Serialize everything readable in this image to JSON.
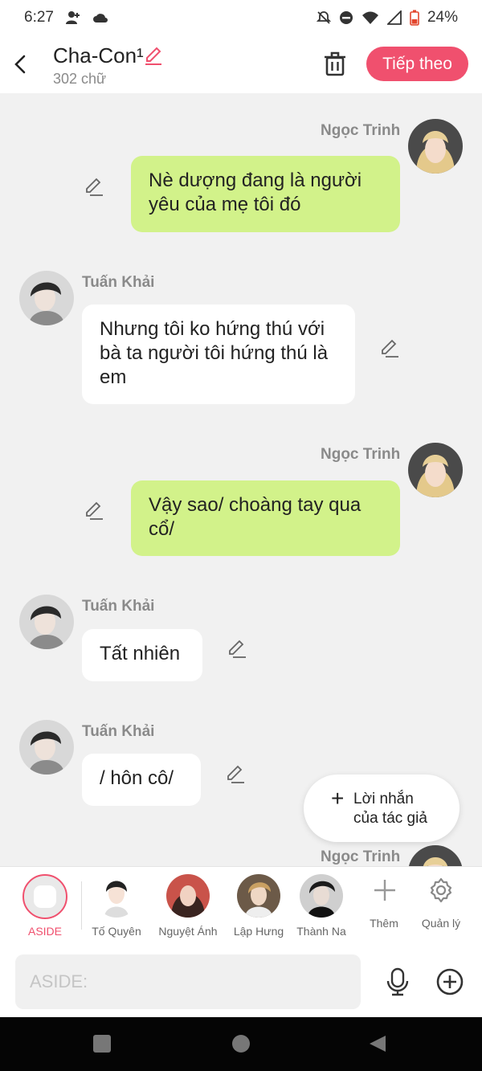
{
  "status_bar": {
    "time": "6:27",
    "battery": "24%"
  },
  "header": {
    "title": "Cha-Con¹",
    "word_count": "302 chữ",
    "next_label": "Tiếp theo"
  },
  "messages": [
    {
      "speaker": "Ngọc Trinh",
      "side": "right",
      "text_lines": [
        "Nè dượng đang là người",
        "yêu của mẹ tôi đó"
      ]
    },
    {
      "speaker": "Tuấn Khải",
      "side": "left",
      "text_lines": [
        "Nhưng tôi ko hứng thú với",
        "bà ta người tôi hứng thú là",
        "em"
      ]
    },
    {
      "speaker": "Ngọc Trinh",
      "side": "right",
      "text_lines": [
        "Vậy sao/ choàng tay qua",
        "cổ/"
      ]
    },
    {
      "speaker": "Tuấn Khải",
      "side": "left",
      "text_lines": [
        "Tất nhiên"
      ]
    },
    {
      "speaker": "Tuấn Khải",
      "side": "left",
      "text_lines": [
        "/ hôn cô/"
      ]
    },
    {
      "speaker": "Ngọc Trinh",
      "side": "right",
      "text_lines": []
    }
  ],
  "author_note": {
    "line1": "Lời nhắn",
    "line2": "của tác giả"
  },
  "characters": [
    {
      "label": "ASIDE"
    },
    {
      "label": "Tố Quyên"
    },
    {
      "label": "Nguyệt Ánh"
    },
    {
      "label": "Lập Hưng"
    },
    {
      "label": "Thành Na"
    },
    {
      "label": "Thêm"
    },
    {
      "label": "Quản lý"
    }
  ],
  "input": {
    "placeholder": "ASIDE:"
  },
  "colors": {
    "accent": "#f0506e",
    "green_bubble": "#d2f28a",
    "white_bubble": "#ffffff",
    "background": "#f1f1f1"
  }
}
